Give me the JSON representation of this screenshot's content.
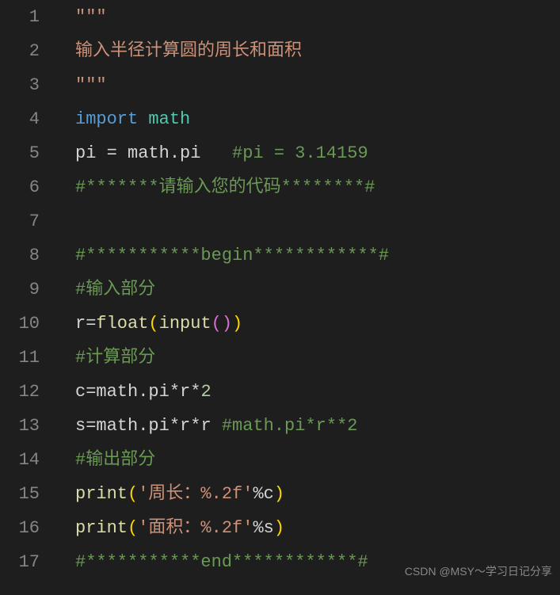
{
  "lineNumbers": [
    "1",
    "2",
    "3",
    "4",
    "5",
    "6",
    "7",
    "8",
    "9",
    "10",
    "11",
    "12",
    "13",
    "14",
    "15",
    "16",
    "17"
  ],
  "code": {
    "l1": {
      "t1": "\"\"\""
    },
    "l2": {
      "t1": "输入半径计算圆的周长和面积"
    },
    "l3": {
      "t1": "\"\"\""
    },
    "l4": {
      "t1": "import",
      "t2": " math"
    },
    "l5": {
      "t1": "pi ",
      "t2": "=",
      "t3": " math",
      "t4": ".",
      "t5": "pi",
      "t6": "   ",
      "t7": "#pi = 3.14159"
    },
    "l6": {
      "t1": "#*******请输入您的代码********#"
    },
    "l7": {
      "t1": ""
    },
    "l8": {
      "t1": "#***********begin************#"
    },
    "l9": {
      "t1": "#输入部分"
    },
    "l10": {
      "t1": "r",
      "t2": "=",
      "t3": "float",
      "t4": "(",
      "t5": "input",
      "t6": "(",
      "t7": ")",
      "t8": ")"
    },
    "l11": {
      "t1": "#计算部分"
    },
    "l12": {
      "t1": "c",
      "t2": "=",
      "t3": "math",
      "t4": ".",
      "t5": "pi",
      "t6": "*",
      "t7": "r",
      "t8": "*",
      "t9": "2"
    },
    "l13": {
      "t1": "s",
      "t2": "=",
      "t3": "math",
      "t4": ".",
      "t5": "pi",
      "t6": "*",
      "t7": "r",
      "t8": "*",
      "t9": "r",
      "t10": " ",
      "t11": "#math.pi*r**2"
    },
    "l14": {
      "t1": "#输出部分"
    },
    "l15": {
      "t1": "print",
      "t2": "(",
      "t3": "'周长：%.2f'",
      "t4": "%",
      "t5": "c",
      "t6": ")"
    },
    "l16": {
      "t1": "print",
      "t2": "(",
      "t3": "'面积：%.2f'",
      "t4": "%",
      "t5": "s",
      "t6": ")"
    },
    "l17": {
      "t1": "#***********end************#"
    }
  },
  "watermark": "CSDN @MSY～学习日记分享"
}
